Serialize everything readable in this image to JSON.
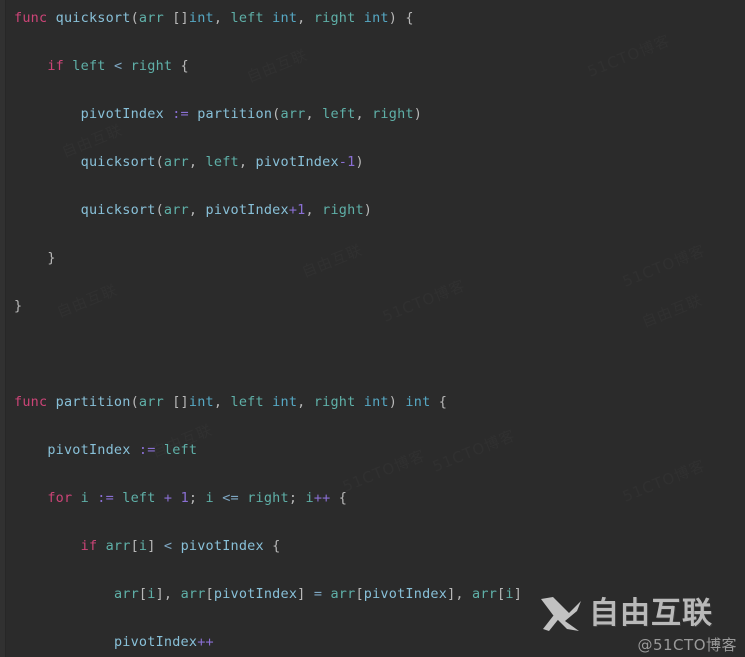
{
  "editor": {
    "language": "go",
    "background_color": "#2b2b2b",
    "colors": {
      "keyword": "#cc4477",
      "function": "#88c0d8",
      "identifier": "#5fb0a8",
      "type": "#56a8c4",
      "number": "#8a6fd4",
      "operator": "#8a6fd4",
      "comparison": "#7fa8c4",
      "punctuation": "#b8b8b8"
    }
  },
  "code_lines": [
    {
      "indent": 0,
      "tokens": [
        {
          "t": "func",
          "c": "kw"
        },
        {
          "t": " ",
          "c": "pun"
        },
        {
          "t": "quicksort",
          "c": "fn"
        },
        {
          "t": "(",
          "c": "pun"
        },
        {
          "t": "arr",
          "c": "id"
        },
        {
          "t": " ",
          "c": "pun"
        },
        {
          "t": "[]",
          "c": "pun"
        },
        {
          "t": "int",
          "c": "typ"
        },
        {
          "t": ", ",
          "c": "pun"
        },
        {
          "t": "left",
          "c": "id"
        },
        {
          "t": " ",
          "c": "pun"
        },
        {
          "t": "int",
          "c": "typ"
        },
        {
          "t": ", ",
          "c": "pun"
        },
        {
          "t": "right",
          "c": "id"
        },
        {
          "t": " ",
          "c": "pun"
        },
        {
          "t": "int",
          "c": "typ"
        },
        {
          "t": ") {",
          "c": "pun"
        }
      ]
    },
    {
      "indent": 0,
      "tokens": []
    },
    {
      "indent": 1,
      "tokens": [
        {
          "t": "if",
          "c": "kw"
        },
        {
          "t": " ",
          "c": "pun"
        },
        {
          "t": "left",
          "c": "id"
        },
        {
          "t": " ",
          "c": "pun"
        },
        {
          "t": "<",
          "c": "cmp"
        },
        {
          "t": " ",
          "c": "pun"
        },
        {
          "t": "right",
          "c": "id"
        },
        {
          "t": " {",
          "c": "pun"
        }
      ]
    },
    {
      "indent": 0,
      "tokens": []
    },
    {
      "indent": 2,
      "tokens": [
        {
          "t": "pivotIndex",
          "c": "fn"
        },
        {
          "t": " ",
          "c": "pun"
        },
        {
          "t": ":=",
          "c": "op"
        },
        {
          "t": " ",
          "c": "pun"
        },
        {
          "t": "partition",
          "c": "fn"
        },
        {
          "t": "(",
          "c": "pun"
        },
        {
          "t": "arr",
          "c": "id"
        },
        {
          "t": ", ",
          "c": "pun"
        },
        {
          "t": "left",
          "c": "id"
        },
        {
          "t": ", ",
          "c": "pun"
        },
        {
          "t": "right",
          "c": "id"
        },
        {
          "t": ")",
          "c": "pun"
        }
      ]
    },
    {
      "indent": 0,
      "tokens": []
    },
    {
      "indent": 2,
      "tokens": [
        {
          "t": "quicksort",
          "c": "fn"
        },
        {
          "t": "(",
          "c": "pun"
        },
        {
          "t": "arr",
          "c": "id"
        },
        {
          "t": ", ",
          "c": "pun"
        },
        {
          "t": "left",
          "c": "id"
        },
        {
          "t": ", ",
          "c": "pun"
        },
        {
          "t": "pivotIndex",
          "c": "fn"
        },
        {
          "t": "-",
          "c": "op"
        },
        {
          "t": "1",
          "c": "num"
        },
        {
          "t": ")",
          "c": "pun"
        }
      ]
    },
    {
      "indent": 0,
      "tokens": []
    },
    {
      "indent": 2,
      "tokens": [
        {
          "t": "quicksort",
          "c": "fn"
        },
        {
          "t": "(",
          "c": "pun"
        },
        {
          "t": "arr",
          "c": "id"
        },
        {
          "t": ", ",
          "c": "pun"
        },
        {
          "t": "pivotIndex",
          "c": "fn"
        },
        {
          "t": "+",
          "c": "op"
        },
        {
          "t": "1",
          "c": "num"
        },
        {
          "t": ", ",
          "c": "pun"
        },
        {
          "t": "right",
          "c": "id"
        },
        {
          "t": ")",
          "c": "pun"
        }
      ]
    },
    {
      "indent": 0,
      "tokens": []
    },
    {
      "indent": 1,
      "tokens": [
        {
          "t": "}",
          "c": "pun"
        }
      ]
    },
    {
      "indent": 0,
      "tokens": []
    },
    {
      "indent": 0,
      "tokens": [
        {
          "t": "}",
          "c": "pun"
        }
      ]
    },
    {
      "indent": 0,
      "tokens": []
    },
    {
      "indent": 0,
      "tokens": []
    },
    {
      "indent": 0,
      "tokens": []
    },
    {
      "indent": 0,
      "tokens": [
        {
          "t": "func",
          "c": "kw"
        },
        {
          "t": " ",
          "c": "pun"
        },
        {
          "t": "partition",
          "c": "fn"
        },
        {
          "t": "(",
          "c": "pun"
        },
        {
          "t": "arr",
          "c": "id"
        },
        {
          "t": " ",
          "c": "pun"
        },
        {
          "t": "[]",
          "c": "pun"
        },
        {
          "t": "int",
          "c": "typ"
        },
        {
          "t": ", ",
          "c": "pun"
        },
        {
          "t": "left",
          "c": "id"
        },
        {
          "t": " ",
          "c": "pun"
        },
        {
          "t": "int",
          "c": "typ"
        },
        {
          "t": ", ",
          "c": "pun"
        },
        {
          "t": "right",
          "c": "id"
        },
        {
          "t": " ",
          "c": "pun"
        },
        {
          "t": "int",
          "c": "typ"
        },
        {
          "t": ") ",
          "c": "pun"
        },
        {
          "t": "int",
          "c": "typ"
        },
        {
          "t": " {",
          "c": "pun"
        }
      ]
    },
    {
      "indent": 0,
      "tokens": []
    },
    {
      "indent": 1,
      "tokens": [
        {
          "t": "pivotIndex",
          "c": "fn"
        },
        {
          "t": " ",
          "c": "pun"
        },
        {
          "t": ":=",
          "c": "op"
        },
        {
          "t": " ",
          "c": "pun"
        },
        {
          "t": "left",
          "c": "id"
        }
      ]
    },
    {
      "indent": 0,
      "tokens": []
    },
    {
      "indent": 1,
      "tokens": [
        {
          "t": "for",
          "c": "kw"
        },
        {
          "t": " ",
          "c": "pun"
        },
        {
          "t": "i",
          "c": "id"
        },
        {
          "t": " ",
          "c": "pun"
        },
        {
          "t": ":=",
          "c": "op"
        },
        {
          "t": " ",
          "c": "pun"
        },
        {
          "t": "left",
          "c": "id"
        },
        {
          "t": " ",
          "c": "pun"
        },
        {
          "t": "+",
          "c": "op"
        },
        {
          "t": " ",
          "c": "pun"
        },
        {
          "t": "1",
          "c": "num"
        },
        {
          "t": "; ",
          "c": "pun"
        },
        {
          "t": "i",
          "c": "id"
        },
        {
          "t": " ",
          "c": "pun"
        },
        {
          "t": "<=",
          "c": "cmp"
        },
        {
          "t": " ",
          "c": "pun"
        },
        {
          "t": "right",
          "c": "id"
        },
        {
          "t": "; ",
          "c": "pun"
        },
        {
          "t": "i",
          "c": "id"
        },
        {
          "t": "++",
          "c": "op"
        },
        {
          "t": " {",
          "c": "pun"
        }
      ]
    },
    {
      "indent": 0,
      "tokens": []
    },
    {
      "indent": 2,
      "tokens": [
        {
          "t": "if",
          "c": "kw"
        },
        {
          "t": " ",
          "c": "pun"
        },
        {
          "t": "arr",
          "c": "id"
        },
        {
          "t": "[",
          "c": "pun"
        },
        {
          "t": "i",
          "c": "id"
        },
        {
          "t": "]",
          "c": "pun"
        },
        {
          "t": " ",
          "c": "pun"
        },
        {
          "t": "<",
          "c": "cmp"
        },
        {
          "t": " ",
          "c": "pun"
        },
        {
          "t": "pivotIndex",
          "c": "fn"
        },
        {
          "t": " {",
          "c": "pun"
        }
      ]
    },
    {
      "indent": 0,
      "tokens": []
    },
    {
      "indent": 3,
      "tokens": [
        {
          "t": "arr",
          "c": "id"
        },
        {
          "t": "[",
          "c": "pun"
        },
        {
          "t": "i",
          "c": "id"
        },
        {
          "t": "], ",
          "c": "pun"
        },
        {
          "t": "arr",
          "c": "id"
        },
        {
          "t": "[",
          "c": "pun"
        },
        {
          "t": "pivotIndex",
          "c": "fn"
        },
        {
          "t": "] ",
          "c": "pun"
        },
        {
          "t": "=",
          "c": "cmp"
        },
        {
          "t": " ",
          "c": "pun"
        },
        {
          "t": "arr",
          "c": "id"
        },
        {
          "t": "[",
          "c": "pun"
        },
        {
          "t": "pivotIndex",
          "c": "fn"
        },
        {
          "t": "], ",
          "c": "pun"
        },
        {
          "t": "arr",
          "c": "id"
        },
        {
          "t": "[",
          "c": "pun"
        },
        {
          "t": "i",
          "c": "id"
        },
        {
          "t": "]",
          "c": "pun"
        }
      ]
    },
    {
      "indent": 0,
      "tokens": []
    },
    {
      "indent": 3,
      "tokens": [
        {
          "t": "pivotIndex",
          "c": "fn"
        },
        {
          "t": "++",
          "c": "op"
        }
      ]
    }
  ],
  "watermark": {
    "brand_cn": "自由互联",
    "handle": "@51CTO博客",
    "logo_icon": "x-logo-icon",
    "background_tiles": [
      "自由互联",
      "51CTO博客",
      "自由互联",
      "51CTO博客"
    ]
  }
}
